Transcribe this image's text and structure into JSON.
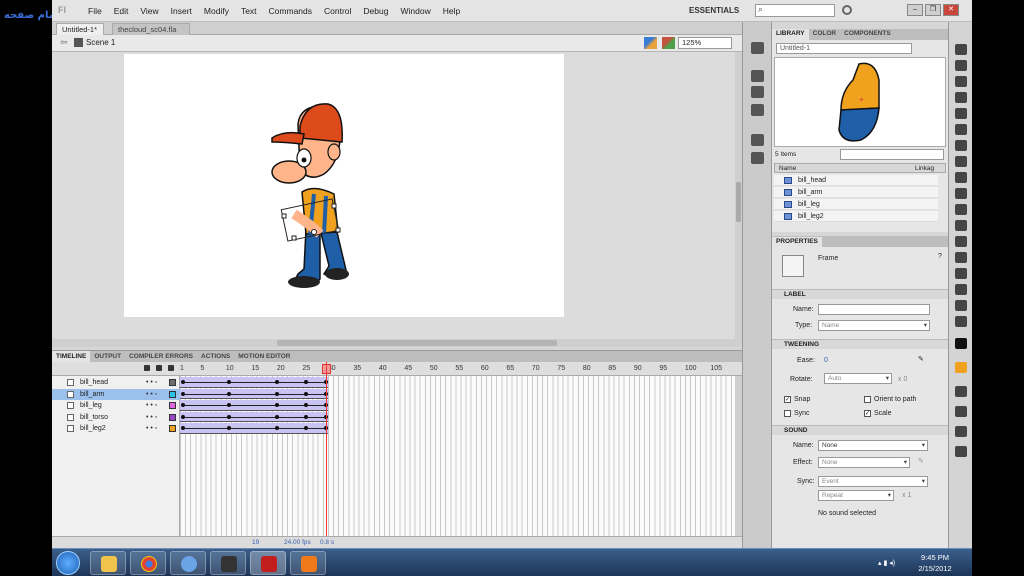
{
  "overlay": {
    "text": "تمام صفحه"
  },
  "menubar": {
    "items": [
      "File",
      "Edit",
      "View",
      "Insert",
      "Modify",
      "Text",
      "Commands",
      "Control",
      "Debug",
      "Window",
      "Help"
    ],
    "workspace": "ESSENTIALS",
    "search_placeholder": ""
  },
  "doc_tabs": [
    "Untitled-1*",
    "thecloud_sc04.fla"
  ],
  "editbar": {
    "scene": "Scene 1",
    "zoom": "125%"
  },
  "timeline": {
    "tabs": [
      "TIMELINE",
      "OUTPUT",
      "COMPILER ERRORS",
      "ACTIONS",
      "MOTION EDITOR"
    ],
    "ruler": [
      "1",
      "5",
      "10",
      "15",
      "20",
      "25",
      "30",
      "35",
      "40",
      "45",
      "50",
      "55",
      "60",
      "65",
      "70",
      "75",
      "80",
      "85",
      "90",
      "95",
      "100",
      "105"
    ],
    "current_frame": "19",
    "fps": "24.00 fps",
    "seconds": "0.8 s",
    "layers": [
      {
        "name": "bill_head",
        "color": "#6e6e6e",
        "selected": false
      },
      {
        "name": "bill_arm",
        "color": "#29c4e8",
        "selected": true
      },
      {
        "name": "bill_leg",
        "color": "#e066e0",
        "selected": false
      },
      {
        "name": "bill_torso",
        "color": "#9a46c8",
        "selected": false
      },
      {
        "name": "bill_leg2",
        "color": "#f0a020",
        "selected": false
      }
    ]
  },
  "library": {
    "tabs": [
      "LIBRARY",
      "COLOR",
      "COMPONENTS"
    ],
    "document": "Untitled-1",
    "count": "5 Items",
    "col_name": "Name",
    "col_linkage": "Linkag",
    "items": [
      "bill_head",
      "bill_arm",
      "bill_leg",
      "bill_leg2"
    ]
  },
  "properties": {
    "tab": "PROPERTIES",
    "type": "Frame",
    "label_section": "LABEL",
    "name_label": "Name:",
    "type_label": "Type:",
    "type_value": "Name",
    "tweening_section": "TWEENING",
    "ease_label": "Ease:",
    "ease_value": "0",
    "rotate_label": "Rotate:",
    "rotate_value": "Auto",
    "rotate_count": "x 0",
    "snap_label": "Snap",
    "orient_label": "Orient to path",
    "sync_label": "Sync",
    "scale_label": "Scale",
    "sound_section": "SOUND",
    "sound_name_label": "Name:",
    "sound_name_value": "None",
    "effect_label": "Effect:",
    "effect_value": "None",
    "sync2_label": "Sync:",
    "sync2_value": "Event",
    "repeat_value": "Repeat",
    "repeat_count": "x 1",
    "no_sound": "No sound selected"
  },
  "taskbar": {
    "time": "9:45 PM",
    "date": "2/15/2012"
  }
}
